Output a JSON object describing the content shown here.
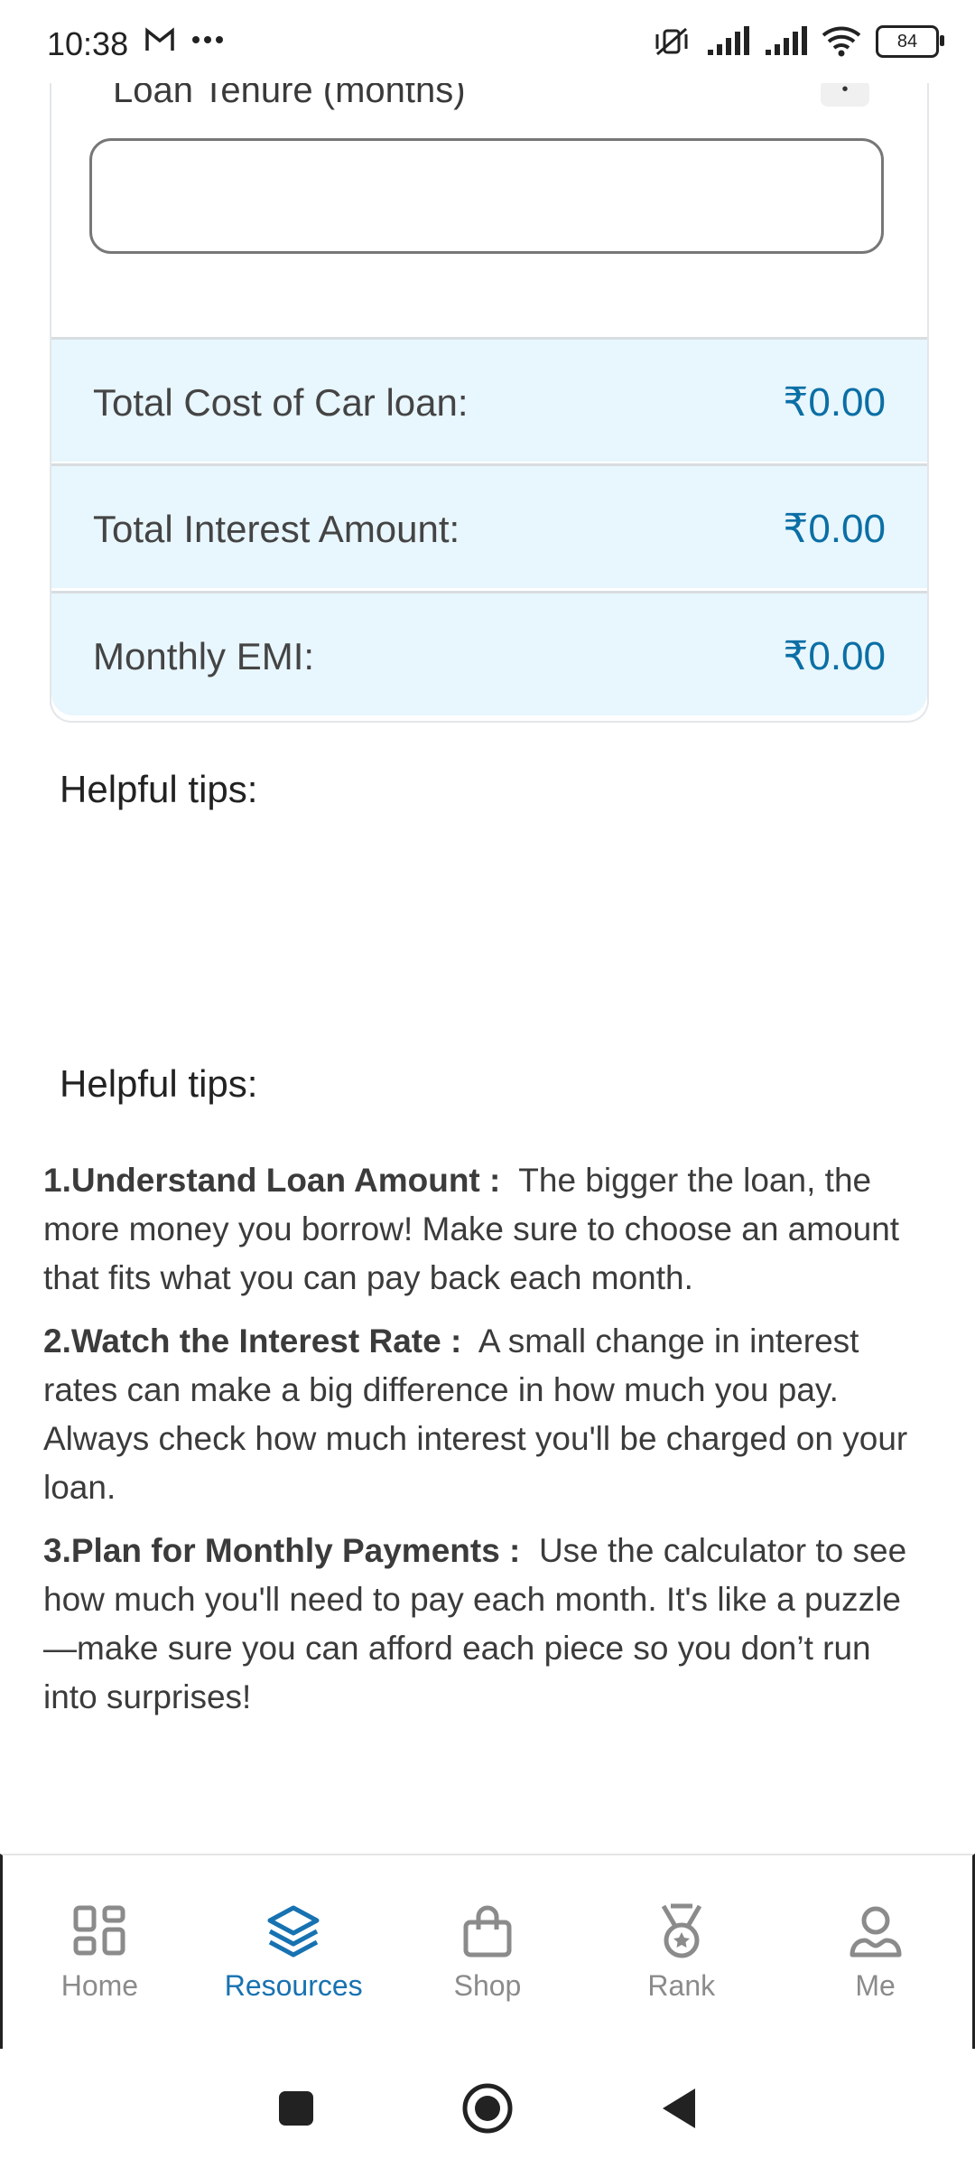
{
  "status_bar": {
    "time": "10:38",
    "battery": "84"
  },
  "calculator": {
    "tenure_label": "Loan Tenure (months)",
    "tenure_value": "",
    "results": [
      {
        "label": "Total Cost of Car loan:",
        "value": "₹0.00"
      },
      {
        "label": "Total Interest Amount:",
        "value": "₹0.00"
      },
      {
        "label": "Monthly EMI:",
        "value": "₹0.00"
      }
    ],
    "accent_color": "#0a6fa5",
    "row_background": "#e8f6fd"
  },
  "tips": {
    "heading_1": "Helpful tips:",
    "heading_2": "Helpful tips:",
    "items": [
      {
        "title": "1.Understand Loan Amount :",
        "text": "The bigger the loan, the more money you borrow! Make sure to choose an amount that fits what you can pay back each month."
      },
      {
        "title": "2.Watch the Interest Rate :",
        "text": "A small change in interest rates can make a big difference in how much you pay. Always check how much interest you'll be charged on your loan."
      },
      {
        "title": "3.Plan for Monthly Payments :",
        "text": "Use the calculator to see how much you'll need to pay each month. It's like a puzzle—make sure you can afford each piece so you don’t run into surprises!"
      }
    ]
  },
  "bottom_nav": {
    "items": [
      {
        "label": "Home",
        "icon": "grid-icon",
        "active": false
      },
      {
        "label": "Resources",
        "icon": "layers-icon",
        "active": true
      },
      {
        "label": "Shop",
        "icon": "shopping-bag-icon",
        "active": false
      },
      {
        "label": "Rank",
        "icon": "medal-icon",
        "active": false
      },
      {
        "label": "Me",
        "icon": "user-icon",
        "active": false
      }
    ],
    "active_color": "#1772b1"
  }
}
